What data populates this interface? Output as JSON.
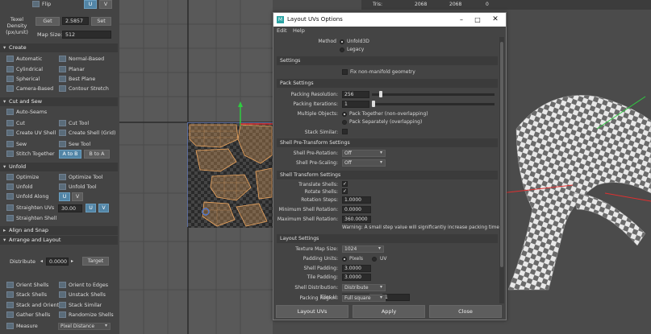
{
  "toolkit": {
    "top_flip": "Flip",
    "top_u": "U",
    "top_v": "V",
    "texel_label": "Texel\nDensity\n(px/unit)",
    "get_label": "Get",
    "texel_value": "2.5857",
    "set_label": "Set",
    "map_size_label": "Map Size:",
    "map_size_value": "512",
    "create": {
      "header": "Create",
      "items": [
        "Automatic",
        "Normal-Based",
        "Cylindrical",
        "Planar",
        "Spherical",
        "Best Plane",
        "Camera-Based",
        "Contour Stretch"
      ]
    },
    "cutsew": {
      "header": "Cut and Sew",
      "auto_seams": "Auto-Seams",
      "cut": "Cut",
      "cut_tool": "Cut Tool",
      "create_uv_shell": "Create UV Shell",
      "create_shell_grid": "Create Shell (Grid)",
      "sew": "Sew",
      "sew_tool": "Sew Tool",
      "stitch_together": "Stitch Together",
      "a_to_b": "A to B",
      "b_to_a": "B to A"
    },
    "unfold": {
      "header": "Unfold",
      "optimize": "Optimize",
      "optimize_tool": "Optimize Tool",
      "unfold": "Unfold",
      "unfold_tool": "Unfold Tool",
      "unfold_along": "Unfold Along",
      "u": "U",
      "v": "V",
      "straighten_uvs": "Straighten UVs",
      "straighten_value": "30.00",
      "straighten_shell": "Straighten Shell"
    },
    "align_header": "Align and Snap",
    "arrange": {
      "header": "Arrange and Layout",
      "distribute": "Distribute",
      "distribute_value": "0.0000",
      "target": "Target",
      "items": [
        "Orient Shells",
        "Orient to Edges",
        "Stack Shells",
        "Unstack Shells",
        "Stack and Orient",
        "Stack Similar",
        "Gather Shells",
        "Randomize Shells"
      ],
      "measure": "Measure",
      "measure_value": "Pixel Distance"
    }
  },
  "viewport": {
    "hud_label": "Tris:",
    "hud_value_1": "2068",
    "hud_value_2": "2068",
    "hud_value_3": "0"
  },
  "dialog": {
    "title": "Layout UVs Options",
    "menu": [
      "Edit",
      "Help"
    ],
    "method_label": "Method",
    "method_unfold3d": "Unfold3D",
    "method_legacy": "Legacy",
    "settings_header": "Settings",
    "fix_nonmanifold": "Fix non-manifold geometry",
    "packing_header": "Pack Settings",
    "packing_resolution_label": "Packing Resolution:",
    "packing_resolution_value": "256",
    "packing_iterations_label": "Packing Iterations:",
    "packing_iterations_value": "1",
    "multiple_objects_label": "Multiple Objects:",
    "pack_together": "Pack Together (non-overlapping)",
    "pack_separately": "Pack Separately (overlapping)",
    "stack_similar_label": "Stack Similar:",
    "shell_pre_header": "Shell Pre-Transform Settings",
    "shell_pre_rotation_label": "Shell Pre-Rotation:",
    "shell_pre_rotation_value": "Off",
    "shell_pre_scaling_label": "Shell Pre-Scaling:",
    "shell_pre_scaling_value": "Off",
    "shell_transform_header": "Shell Transform Settings",
    "translate_shells_label": "Translate Shells:",
    "rotate_shells_label": "Rotate Shells:",
    "rotation_steps_label": "Rotation Steps:",
    "rotation_steps_value": "1.0000",
    "min_shell_rotation_label": "Minimum Shell Rotation:",
    "min_shell_rotation_value": "0.0000",
    "max_shell_rotation_label": "Maximum Shell Rotation:",
    "max_shell_rotation_value": "360.0000",
    "warning": "Warning: A small step value will significantly increase packing time.",
    "layout_header": "Layout Settings",
    "texture_map_size_label": "Texture Map Size:",
    "texture_map_size_value": "1024",
    "padding_units_label": "Padding Units:",
    "padding_pixels": "Pixels",
    "padding_uv": "UV",
    "shell_padding_label": "Shell Padding:",
    "shell_padding_value": "3.0000",
    "tile_padding_label": "Tile Padding:",
    "tile_padding_value": "3.0000",
    "shell_distribution_label": "Shell Distribution:",
    "shell_distribution_value": "Distribute",
    "tiles_u_label": "Tiles U:",
    "tiles_u_value": "1",
    "tiles_v_label": "V:",
    "tiles_v_value": "1",
    "packing_region_label": "Packing Region:",
    "packing_region_value": "Full square",
    "button_layout": "Layout UVs",
    "button_apply": "Apply",
    "button_close": "Close"
  }
}
